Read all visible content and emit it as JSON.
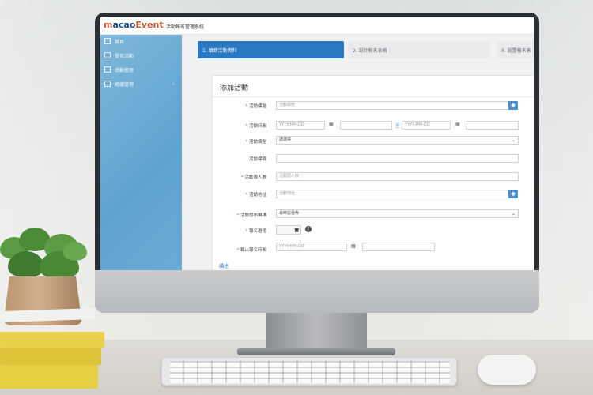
{
  "app": {
    "logo_letter": "m",
    "logo_rest": "acao",
    "logo_emph": "Event",
    "subtitle": "活動報名管理系統"
  },
  "sidebar": {
    "items": [
      {
        "label": "首頁",
        "icon": "home-icon"
      },
      {
        "label": "發布活動",
        "icon": "edit-icon"
      },
      {
        "label": "活動管理",
        "icon": "calendar-icon"
      },
      {
        "label": "組織管理",
        "icon": "org-chart-icon",
        "chevron": "‹"
      }
    ]
  },
  "steps": [
    {
      "label": "1. 填寫活動資料",
      "active": true
    },
    {
      "label": "2. 設計報名表格",
      "active": false
    },
    {
      "label": "3. 設置報名表",
      "active": false
    }
  ],
  "form": {
    "title": "添加活動",
    "fields": {
      "title": {
        "label": "活動標題",
        "required": true,
        "placeholder": "活動標題",
        "addon": "●"
      },
      "time": {
        "label": "活動時間",
        "required": true,
        "start_placeholder": "YYYY-MM-DD",
        "end_placeholder": "YYYY-MM-DD",
        "to": "至",
        "cal_icon": "▦"
      },
      "type": {
        "label": "活動類型",
        "required": true,
        "value": "請選擇"
      },
      "tags": {
        "label": "活動標籤",
        "required": false
      },
      "capacity": {
        "label": "活動限人數",
        "required": true,
        "placeholder": "活動限人數"
      },
      "location": {
        "label": "活動地址",
        "required": true,
        "placeholder": "活動地址",
        "addon": "●"
      },
      "publisher": {
        "label": "活動發布機構",
        "required": true,
        "value": "尋樂設發佈"
      },
      "color": {
        "label": "報名邀粗",
        "required": true,
        "button_icon": "■",
        "help": "?"
      },
      "deadline": {
        "label": "截止報名時間",
        "required": true,
        "placeholder": "YYYY-MM-DD",
        "cal_icon": "▦"
      }
    },
    "footer_link": "描述"
  },
  "colors": {
    "accent": "#2a78c2",
    "sidebar": "#6aabd4",
    "required": "#d9534f"
  }
}
